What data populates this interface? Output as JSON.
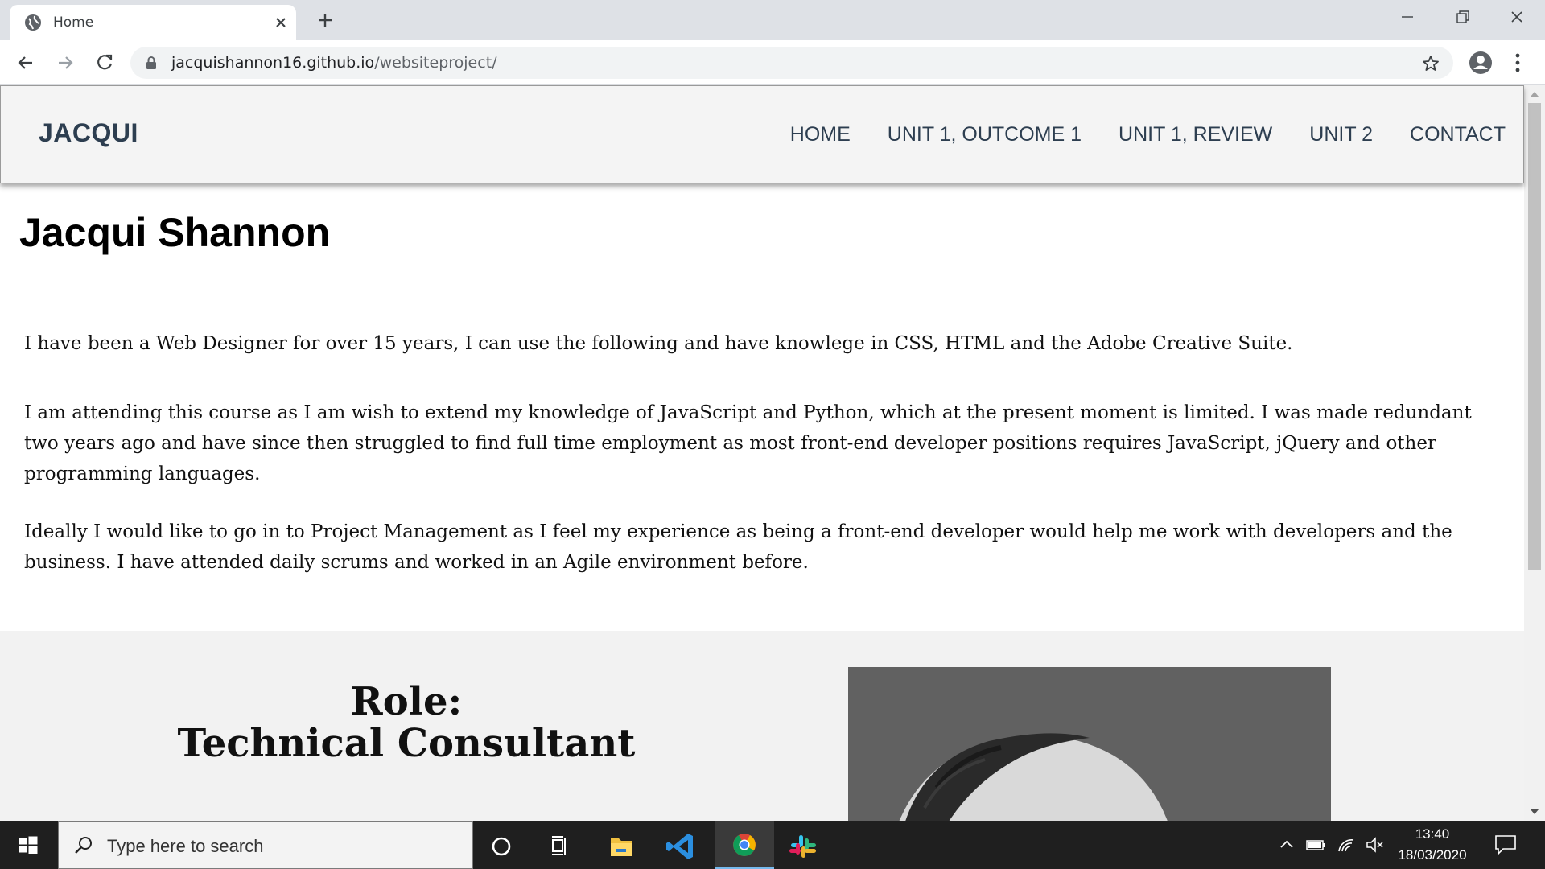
{
  "browser": {
    "tab_title": "Home",
    "url_host": "jacquishannon16.github.io",
    "url_path": "/websiteproject/"
  },
  "site": {
    "logo": "JACQUI",
    "nav": [
      {
        "label": "HOME"
      },
      {
        "label": "UNIT 1, OUTCOME 1"
      },
      {
        "label": "UNIT 1, REVIEW"
      },
      {
        "label": "UNIT 2"
      },
      {
        "label": "CONTACT"
      }
    ],
    "heading": "Jacqui Shannon",
    "paragraphs": [
      "I have been a Web Designer for over 15 years, I can use the following and have knowlege in CSS, HTML and the Adobe Creative Suite.",
      "I am attending this course as I am wish to extend my knowledge of JavaScript and Python, which at the present moment is limited. I was made redundant two years ago and have since then struggled to find full time employment as most front-end developer positions requires JavaScript, jQuery and other programming languages.",
      "Ideally I would like to go in to Project Management as I feel my experience as being a front-end developer would help me work with developers and the business. I have attended daily scrums and worked in an Agile environment before."
    ],
    "role_title": "Role:",
    "role_value": "Technical Consultant"
  },
  "taskbar": {
    "search_placeholder": "Type here to search",
    "time": "13:40",
    "date": "18/03/2020"
  },
  "colors": {
    "header_bg": "#f4f4f4",
    "nav_text": "#2d3e50",
    "taskbar_bg": "#1f1f1f",
    "chrome_tabstrip": "#dee1e6"
  }
}
